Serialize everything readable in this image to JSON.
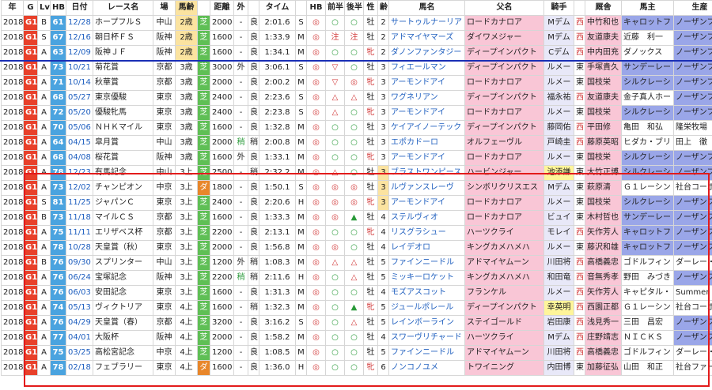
{
  "headers": [
    "年",
    "G",
    "Lv",
    "HB",
    "日付",
    "レース名",
    "場",
    "馬齢",
    "",
    "距離",
    "外",
    "",
    "タイム",
    "",
    "HB",
    "前半",
    "後半",
    "性",
    "齢",
    "馬名",
    "父名",
    "騎手",
    "",
    "厩舎",
    "馬主",
    "生産"
  ],
  "rows": [
    {
      "y": "2018",
      "g": "G1",
      "lv": "B",
      "hb": "61",
      "date": "12/28",
      "race": "ホープフルＳ",
      "track": "中山",
      "age": "2歳",
      "surf": "芝",
      "dist": "2000",
      "out": "-",
      "cond": "良",
      "time": "2:01.6",
      "m": "S",
      "hbm": "◎",
      "front": "○",
      "back": "○",
      "sex": "牡",
      "ag": "2",
      "horse": "サートゥルナーリア",
      "sire": "ロードカナロア",
      "jockey": "Mデム",
      "jm": "",
      "west": "西",
      "stable": "中竹和也",
      "owner": "キャロットフ",
      "breeder": "ノーザンファ"
    },
    {
      "y": "2018",
      "g": "G1",
      "lv": "S",
      "hb": "67",
      "date": "12/16",
      "race": "朝日杯ＦＳ",
      "track": "阪神",
      "age": "2歳",
      "surf": "芝",
      "dist": "1600",
      "out": "-",
      "cond": "良",
      "time": "1:33.9",
      "m": "M",
      "hbm": "◎",
      "front": "注",
      "back": "注",
      "sex": "牡",
      "ag": "2",
      "horse": "アドマイヤマーズ",
      "sire": "ダイワメジャー",
      "jockey": "Mデム",
      "jm": "",
      "west": "西",
      "stable": "友道康夫",
      "owner": "近藤　利一",
      "breeder": "ノーザンファ"
    },
    {
      "y": "2018",
      "g": "G1",
      "lv": "A",
      "hb": "63",
      "date": "12/09",
      "race": "阪神ＪＦ",
      "track": "阪神",
      "age": "2歳",
      "surf": "芝",
      "dist": "1600",
      "out": "-",
      "cond": "良",
      "time": "1:34.1",
      "m": "M",
      "hbm": "◎",
      "front": "○",
      "back": "○",
      "sex": "牝",
      "ag": "2",
      "horse": "ダノンファンタジー",
      "sire": "ディープインパクト",
      "jockey": "Cデム",
      "jm": "",
      "west": "西",
      "stable": "中内田充",
      "owner": "ダノックス",
      "breeder": "ノーザンファ"
    },
    {
      "y": "2018",
      "g": "G1",
      "lv": "A",
      "hb": "73",
      "date": "10/21",
      "race": "菊花賞",
      "track": "京都",
      "age": "3歳",
      "surf": "芝",
      "dist": "3000",
      "out": "外",
      "cond": "良",
      "time": "3:06.1",
      "m": "S",
      "hbm": "◎",
      "front": "▽",
      "back": "○",
      "sex": "牡",
      "ag": "3",
      "horse": "フィエールマン",
      "sire": "ディープインパクト",
      "jockey": "ルメー",
      "jm": "",
      "west": "東",
      "stable": "手塚貴久",
      "owner": "サンデーレー",
      "breeder": "ノーザンファ"
    },
    {
      "y": "2018",
      "g": "G1",
      "lv": "A",
      "hb": "71",
      "date": "10/14",
      "race": "秋華賞",
      "track": "京都",
      "age": "3歳",
      "surf": "芝",
      "dist": "2000",
      "out": "-",
      "cond": "良",
      "time": "2:00.2",
      "m": "M",
      "hbm": "◎",
      "front": "▽",
      "back": "◎",
      "sex": "牝",
      "ag": "3",
      "horse": "アーモンドアイ",
      "sire": "ロードカナロア",
      "jockey": "ルメー",
      "jm": "",
      "west": "東",
      "stable": "国枝栄",
      "owner": "シルクレーシ",
      "breeder": "ノーザンファ"
    },
    {
      "y": "2018",
      "g": "G1",
      "lv": "A",
      "hb": "68",
      "date": "05/27",
      "race": "東京優駿",
      "track": "東京",
      "age": "3歳",
      "surf": "芝",
      "dist": "2400",
      "out": "-",
      "cond": "良",
      "time": "2:23.6",
      "m": "S",
      "hbm": "◎",
      "front": "△",
      "back": "△",
      "sex": "牡",
      "ag": "3",
      "horse": "ワグネリアン",
      "sire": "ディープインパクト",
      "jockey": "福永祐",
      "jm": "",
      "west": "西",
      "stable": "友道康夫",
      "owner": "金子真人ホー",
      "breeder": "ノーザンファ"
    },
    {
      "y": "2018",
      "g": "G1",
      "lv": "A",
      "hb": "72",
      "date": "05/20",
      "race": "優駿牝馬",
      "track": "東京",
      "age": "3歳",
      "surf": "芝",
      "dist": "2400",
      "out": "-",
      "cond": "良",
      "time": "2:23.8",
      "m": "S",
      "hbm": "◎",
      "front": "△",
      "back": "○",
      "sex": "牝",
      "ag": "3",
      "horse": "アーモンドアイ",
      "sire": "ロードカナロア",
      "jockey": "ルメー",
      "jm": "",
      "west": "東",
      "stable": "国枝栄",
      "owner": "シルクレーシ",
      "breeder": "ノーザンファ"
    },
    {
      "y": "2018",
      "g": "G1",
      "lv": "A",
      "hb": "70",
      "date": "05/06",
      "race": "ＮＨＫマイル",
      "track": "東京",
      "age": "3歳",
      "surf": "芝",
      "dist": "1600",
      "out": "-",
      "cond": "良",
      "time": "1:32.8",
      "m": "M",
      "hbm": "◎",
      "front": "○",
      "back": "○",
      "sex": "牡",
      "ag": "3",
      "horse": "ケイアイノーテック",
      "sire": "ディープインパクト",
      "jockey": "藤岡佑",
      "jm": "",
      "west": "西",
      "stable": "平田修",
      "owner": "亀田　和弘",
      "breeder": "隆栄牧場"
    },
    {
      "y": "2018",
      "g": "G1",
      "lv": "A",
      "hb": "64",
      "date": "04/15",
      "race": "皐月賞",
      "track": "中山",
      "age": "3歳",
      "surf": "芝",
      "dist": "2000",
      "out": "稍",
      "cond": "稍",
      "time": "2:00.8",
      "m": "M",
      "hbm": "◎",
      "front": "○",
      "back": "○",
      "sex": "牡",
      "ag": "3",
      "horse": "エポカドーロ",
      "sire": "オルフェーヴル",
      "jockey": "戸崎圭",
      "jm": "",
      "west": "西",
      "stable": "藤原英昭",
      "owner": "ヒダカ・ブリ",
      "breeder": "田上　徹"
    },
    {
      "y": "2018",
      "g": "G1",
      "lv": "A",
      "hb": "68",
      "date": "04/08",
      "race": "桜花賞",
      "track": "阪神",
      "age": "3歳",
      "surf": "芝",
      "dist": "1600",
      "out": "外",
      "cond": "良",
      "time": "1:33.1",
      "m": "M",
      "hbm": "◎",
      "front": "○",
      "back": "○",
      "sex": "牝",
      "ag": "3",
      "horse": "アーモンドアイ",
      "sire": "ロードカナロア",
      "jockey": "ルメー",
      "jm": "",
      "west": "東",
      "stable": "国枝栄",
      "owner": "シルクレーシ",
      "breeder": "ノーザンファ"
    },
    {
      "y": "2018",
      "g": "G1",
      "lv": "A",
      "hb": "78",
      "date": "12/23",
      "race": "有馬記念",
      "track": "中山",
      "age": "3上",
      "surf": "芝",
      "dist": "2500",
      "out": "-",
      "cond": "稍",
      "time": "2:32.2",
      "m": "M",
      "hbm": "◎",
      "front": "△",
      "back": "○",
      "sex": "牡",
      "ag": "3",
      "horse": "ブラストワンピース",
      "sire": "ハービンジャー",
      "jockey": "池添謙",
      "jm": "y",
      "west": "東",
      "stable": "大竹正博",
      "owner": "シルクレーシ",
      "breeder": "ノーザンファ"
    },
    {
      "y": "2018",
      "g": "G1",
      "lv": "A",
      "hb": "73",
      "date": "12/02",
      "race": "チャンピオン",
      "track": "中京",
      "age": "3上",
      "surf": "ダ",
      "dist": "1800",
      "out": "-",
      "cond": "良",
      "time": "1:50.1",
      "m": "S",
      "hbm": "◎",
      "front": "◎",
      "back": "◎",
      "sex": "牡",
      "ag": "3",
      "horse": "ルヴァンスレーヴ",
      "sire": "シンボリクリスエス",
      "jockey": "Mデム",
      "jm": "",
      "west": "東",
      "stable": "萩原清",
      "owner": "Ｇ１レーシン",
      "breeder": "社台コーポレ"
    },
    {
      "y": "2018",
      "g": "G1",
      "lv": "S",
      "hb": "81",
      "date": "11/25",
      "race": "ジャパンＣ",
      "track": "東京",
      "age": "3上",
      "surf": "芝",
      "dist": "2400",
      "out": "-",
      "cond": "良",
      "time": "2:20.6",
      "m": "H",
      "hbm": "◎",
      "front": "◎",
      "back": "◎",
      "sex": "牝",
      "ag": "3",
      "horse": "アーモンドアイ",
      "sire": "ロードカナロア",
      "jockey": "ルメー",
      "jm": "",
      "west": "東",
      "stable": "国枝栄",
      "owner": "シルクレーシ",
      "breeder": "ノーザンファ"
    },
    {
      "y": "2018",
      "g": "G1",
      "lv": "B",
      "hb": "73",
      "date": "11/18",
      "race": "マイルＣＳ",
      "track": "京都",
      "age": "3上",
      "surf": "芝",
      "dist": "1600",
      "out": "-",
      "cond": "良",
      "time": "1:33.3",
      "m": "M",
      "hbm": "◎",
      "front": "◎",
      "back": "▲",
      "sex": "牡",
      "ag": "4",
      "horse": "ステルヴィオ",
      "sire": "ロードカナロア",
      "jockey": "ビュイ",
      "jm": "",
      "west": "東",
      "stable": "木村哲也",
      "owner": "サンデーレー",
      "breeder": "ノーザンファ"
    },
    {
      "y": "2018",
      "g": "G1",
      "lv": "A",
      "hb": "75",
      "date": "11/11",
      "race": "エリザベス杯",
      "track": "京都",
      "age": "3上",
      "surf": "芝",
      "dist": "2200",
      "out": "-",
      "cond": "良",
      "time": "2:13.1",
      "m": "M",
      "hbm": "◎",
      "front": "○",
      "back": "○",
      "sex": "牝",
      "ag": "4",
      "horse": "リスグラシュー",
      "sire": "ハーツクライ",
      "jockey": "モレイ",
      "jm": "",
      "west": "西",
      "stable": "矢作芳人",
      "owner": "キャロットフ",
      "breeder": "ノーザンファ"
    },
    {
      "y": "2018",
      "g": "G1",
      "lv": "A",
      "hb": "78",
      "date": "10/28",
      "race": "天皇賞（秋）",
      "track": "東京",
      "age": "3上",
      "surf": "芝",
      "dist": "2000",
      "out": "-",
      "cond": "良",
      "time": "1:56.8",
      "m": "M",
      "hbm": "◎",
      "front": "◎",
      "back": "○",
      "sex": "牡",
      "ag": "4",
      "horse": "レイデオロ",
      "sire": "キングカメハメハ",
      "jockey": "ルメー",
      "jm": "",
      "west": "東",
      "stable": "藤沢和雄",
      "owner": "キャロットフ",
      "breeder": "ノーザンファ"
    },
    {
      "y": "2018",
      "g": "G1",
      "lv": "B",
      "hb": "76",
      "date": "09/30",
      "race": "スプリンター",
      "track": "中山",
      "age": "3上",
      "surf": "芝",
      "dist": "1200",
      "out": "外",
      "cond": "稍",
      "time": "1:08.3",
      "m": "M",
      "hbm": "◎",
      "front": "△",
      "back": "△",
      "sex": "牡",
      "ag": "5",
      "horse": "ファインニードル",
      "sire": "アドマイヤムーン",
      "jockey": "川田将",
      "jm": "",
      "west": "西",
      "stable": "高橋義忠",
      "owner": "ゴドルフィン",
      "breeder": "ダーレー・ジ"
    },
    {
      "y": "2018",
      "g": "G1",
      "lv": "A",
      "hb": "76",
      "date": "06/24",
      "race": "宝塚記念",
      "track": "阪神",
      "age": "3上",
      "surf": "芝",
      "dist": "2200",
      "out": "稍",
      "cond": "稍",
      "time": "2:11.6",
      "m": "H",
      "hbm": "◎",
      "front": "○",
      "back": "△",
      "sex": "牡",
      "ag": "5",
      "horse": "ミッキーロケット",
      "sire": "キングカメハメハ",
      "jockey": "和田竜",
      "jm": "",
      "west": "西",
      "stable": "音無秀孝",
      "owner": "野田　みづき",
      "breeder": "ノーザンファ"
    },
    {
      "y": "2018",
      "g": "G1",
      "lv": "A",
      "hb": "76",
      "date": "06/03",
      "race": "安田記念",
      "track": "東京",
      "age": "3上",
      "surf": "芝",
      "dist": "1600",
      "out": "-",
      "cond": "良",
      "time": "1:31.3",
      "m": "M",
      "hbm": "◎",
      "front": "○",
      "back": "○",
      "sex": "牡",
      "ag": "4",
      "horse": "モズアスコット",
      "sire": "フランケル",
      "jockey": "ルメー",
      "jm": "",
      "west": "西",
      "stable": "矢作芳人",
      "owner": "キャピタル・",
      "breeder": "Summer"
    },
    {
      "y": "2018",
      "g": "G1",
      "lv": "A",
      "hb": "74",
      "date": "05/13",
      "race": "ヴィクトリア",
      "track": "東京",
      "age": "4上",
      "surf": "芝",
      "dist": "1600",
      "out": "-",
      "cond": "稍",
      "time": "1:32.3",
      "m": "M",
      "hbm": "◎",
      "front": "○",
      "back": "▲",
      "sex": "牝",
      "ag": "5",
      "horse": "ジュールポレール",
      "sire": "ディープインパクト",
      "jockey": "幸英明",
      "jm": "y",
      "west": "西",
      "stable": "西園正都",
      "owner": "Ｇ１レーシン",
      "breeder": "社台コーポレ"
    },
    {
      "y": "2018",
      "g": "G1",
      "lv": "A",
      "hb": "76",
      "date": "04/29",
      "race": "天皇賞（春）",
      "track": "京都",
      "age": "4上",
      "surf": "芝",
      "dist": "3200",
      "out": "-",
      "cond": "良",
      "time": "3:16.2",
      "m": "S",
      "hbm": "◎",
      "front": "○",
      "back": "△",
      "sex": "牡",
      "ag": "5",
      "horse": "レインボーライン",
      "sire": "ステイゴールド",
      "jockey": "岩田康",
      "jm": "",
      "west": "西",
      "stable": "浅見秀一",
      "owner": "三田　昌宏",
      "breeder": "ノーザンファ"
    },
    {
      "y": "2018",
      "g": "G1",
      "lv": "A",
      "hb": "77",
      "date": "04/01",
      "race": "大阪杯",
      "track": "阪神",
      "age": "4上",
      "surf": "芝",
      "dist": "2000",
      "out": "-",
      "cond": "良",
      "time": "1:58.2",
      "m": "M",
      "hbm": "◎",
      "front": "○",
      "back": "○",
      "sex": "牡",
      "ag": "4",
      "horse": "スワーヴリチャード",
      "sire": "ハーツクライ",
      "jockey": "Mデム",
      "jm": "",
      "west": "西",
      "stable": "庄野靖志",
      "owner": "ＮＩＣＫＳ",
      "breeder": "ノーザンファ"
    },
    {
      "y": "2018",
      "g": "G1",
      "lv": "A",
      "hb": "75",
      "date": "03/25",
      "race": "高松宮記念",
      "track": "中京",
      "age": "4上",
      "surf": "芝",
      "dist": "1200",
      "out": "-",
      "cond": "良",
      "time": "1:08.5",
      "m": "M",
      "hbm": "◎",
      "front": "○",
      "back": "○",
      "sex": "牡",
      "ag": "5",
      "horse": "ファインニードル",
      "sire": "アドマイヤムーン",
      "jockey": "川田将",
      "jm": "",
      "west": "西",
      "stable": "高橋義忠",
      "owner": "ゴドルフィン",
      "breeder": "ダーレー・ジ"
    },
    {
      "y": "2018",
      "g": "G1",
      "lv": "A",
      "hb": "78",
      "date": "02/18",
      "race": "フェブラリー",
      "track": "東京",
      "age": "4上",
      "surf": "ダ",
      "dist": "1600",
      "out": "-",
      "cond": "良",
      "time": "1:36.0",
      "m": "H",
      "hbm": "◎",
      "front": "○",
      "back": "○",
      "sex": "牝",
      "ag": "6",
      "horse": "ノンコノユメ",
      "sire": "トワイニング",
      "jockey": "内田博",
      "jm": "",
      "west": "東",
      "stable": "加藤征弘",
      "owner": "山田　和正",
      "breeder": "社台ファーム"
    }
  ]
}
